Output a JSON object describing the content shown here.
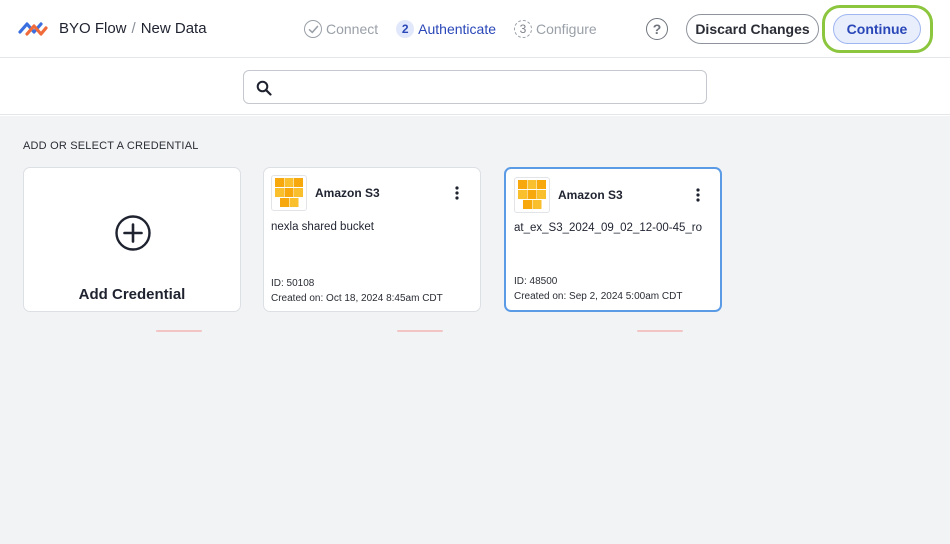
{
  "header": {
    "breadcrumb_root": "BYO Flow",
    "breadcrumb_separator": "/",
    "breadcrumb_current": "New Data",
    "steps": [
      {
        "number": "",
        "label": "Connect",
        "state": "done"
      },
      {
        "number": "2",
        "label": "Authenticate",
        "state": "active"
      },
      {
        "number": "3",
        "label": "Configure",
        "state": "pending"
      }
    ],
    "help_label": "?",
    "discard_label": "Discard Changes",
    "continue_label": "Continue"
  },
  "search": {
    "value": "",
    "placeholder": ""
  },
  "main": {
    "section_title": "ADD OR SELECT A CREDENTIAL",
    "add_card_label": "Add Credential",
    "credentials": [
      {
        "name": "Amazon S3",
        "description": "nexla shared bucket",
        "id_text": "ID: 50108",
        "created_text": "Created on: Oct 18, 2024 8:45am CDT",
        "selected": false
      },
      {
        "name": "Amazon S3",
        "description": "at_ex_S3_2024_09_02_12-00-45_ro",
        "id_text": "ID: 48500",
        "created_text": "Created on: Sep 2, 2024 5:00am CDT",
        "selected": true
      }
    ]
  },
  "colors": {
    "accent": "#2a47b8",
    "highlight_ring": "#8cc63f",
    "selected_border": "#5b9be6",
    "s3_orange": "#f7a80d"
  },
  "icons": {
    "logo": "byo-flow-logo-icon",
    "connect_step": "check-circle-icon",
    "help": "help-circle-icon",
    "search": "search-icon",
    "add": "add-circle-icon",
    "credential": "amazon-s3-icon",
    "menu": "kebab-menu-icon"
  }
}
